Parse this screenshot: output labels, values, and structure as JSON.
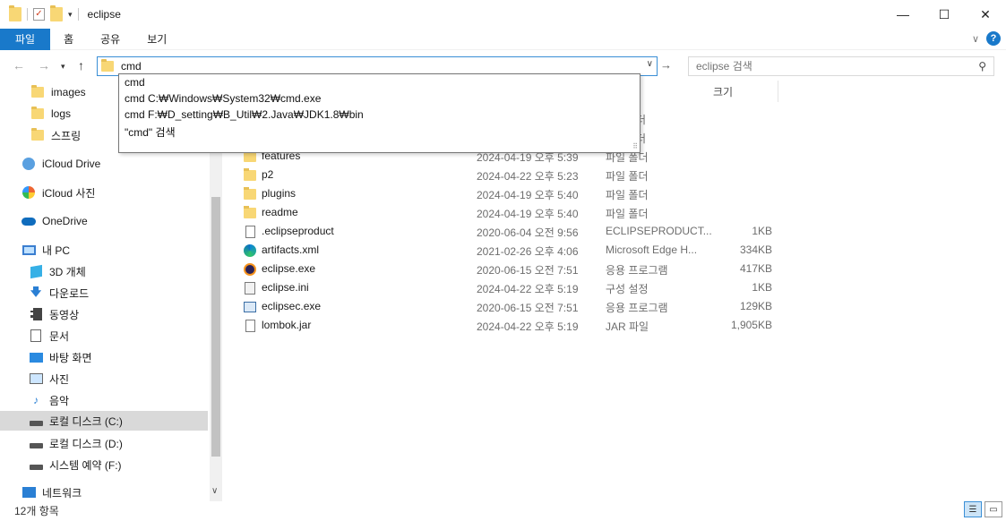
{
  "window": {
    "title": "eclipse",
    "minimize": "—",
    "maximize": "☐",
    "close": "✕"
  },
  "ribbon": {
    "tabs": [
      "파일",
      "홈",
      "공유",
      "보기"
    ],
    "help": "?"
  },
  "address": {
    "value": "cmd"
  },
  "search": {
    "placeholder": "eclipse 검색"
  },
  "autocomplete": {
    "options": [
      "cmd",
      "cmd C:₩Windows₩System32₩cmd.exe",
      "cmd F:₩D_setting₩B_Util₩2.Java₩JDK1.8₩bin",
      "\"cmd\" 검색"
    ]
  },
  "sidebar": {
    "items": [
      {
        "label": "images",
        "icon": "folder-icon"
      },
      {
        "label": "logs",
        "icon": "folder-icon"
      },
      {
        "label": "스프링",
        "icon": "folder-icon"
      },
      {
        "label": "iCloud Drive",
        "icon": "icloud-icon"
      },
      {
        "label": "iCloud 사진",
        "icon": "icloud-photos-icon"
      },
      {
        "label": "OneDrive",
        "icon": "onedrive-icon"
      },
      {
        "label": "내 PC",
        "icon": "pc-icon"
      },
      {
        "label": "3D 개체",
        "icon": "cube-icon"
      },
      {
        "label": "다운로드",
        "icon": "download-icon"
      },
      {
        "label": "동영상",
        "icon": "video-icon"
      },
      {
        "label": "문서",
        "icon": "document-icon"
      },
      {
        "label": "바탕 화면",
        "icon": "desktop-icon"
      },
      {
        "label": "사진",
        "icon": "pictures-icon"
      },
      {
        "label": "음악",
        "icon": "music-icon"
      },
      {
        "label": "로컬 디스크 (C:)",
        "icon": "drive-icon"
      },
      {
        "label": "로컬 디스크 (D:)",
        "icon": "drive-icon"
      },
      {
        "label": "시스템 예약 (F:)",
        "icon": "drive-icon"
      },
      {
        "label": "네트워크",
        "icon": "network-icon"
      }
    ],
    "selected": "로컬 디스크 (C:)"
  },
  "filelist": {
    "size_header": "크기",
    "partial_rows": [
      {
        "name": "",
        "type": "더"
      },
      {
        "name": "",
        "type": "더"
      },
      {
        "name": "features",
        "date": "2024-04-19 오후 5:39",
        "type": "파일 폴더"
      }
    ],
    "rows": [
      {
        "name": "p2",
        "date": "2024-04-22 오후 5:23",
        "type": "파일 폴더",
        "size": "",
        "icon": "folder-icon"
      },
      {
        "name": "plugins",
        "date": "2024-04-19 오후 5:40",
        "type": "파일 폴더",
        "size": "",
        "icon": "folder-icon"
      },
      {
        "name": "readme",
        "date": "2024-04-19 오후 5:40",
        "type": "파일 폴더",
        "size": "",
        "icon": "folder-icon"
      },
      {
        "name": ".eclipseproduct",
        "date": "2020-06-04 오전 9:56",
        "type": "ECLIPSEPRODUCT...",
        "size": "1KB",
        "icon": "file-icon"
      },
      {
        "name": "artifacts.xml",
        "date": "2021-02-26 오후 4:06",
        "type": "Microsoft Edge H...",
        "size": "334KB",
        "icon": "edge-icon"
      },
      {
        "name": "eclipse.exe",
        "date": "2020-06-15 오전 7:51",
        "type": "응용 프로그램",
        "size": "417KB",
        "icon": "eclipse-icon"
      },
      {
        "name": "eclipse.ini",
        "date": "2024-04-22 오후 5:19",
        "type": "구성 설정",
        "size": "1KB",
        "icon": "settings-file-icon"
      },
      {
        "name": "eclipsec.exe",
        "date": "2020-06-15 오전 7:51",
        "type": "응용 프로그램",
        "size": "129KB",
        "icon": "exe-icon"
      },
      {
        "name": "lombok.jar",
        "date": "2024-04-22 오후 5:19",
        "type": "JAR 파일",
        "size": "1,905KB",
        "icon": "file-icon"
      }
    ]
  },
  "status": {
    "count": "12개 항목"
  }
}
